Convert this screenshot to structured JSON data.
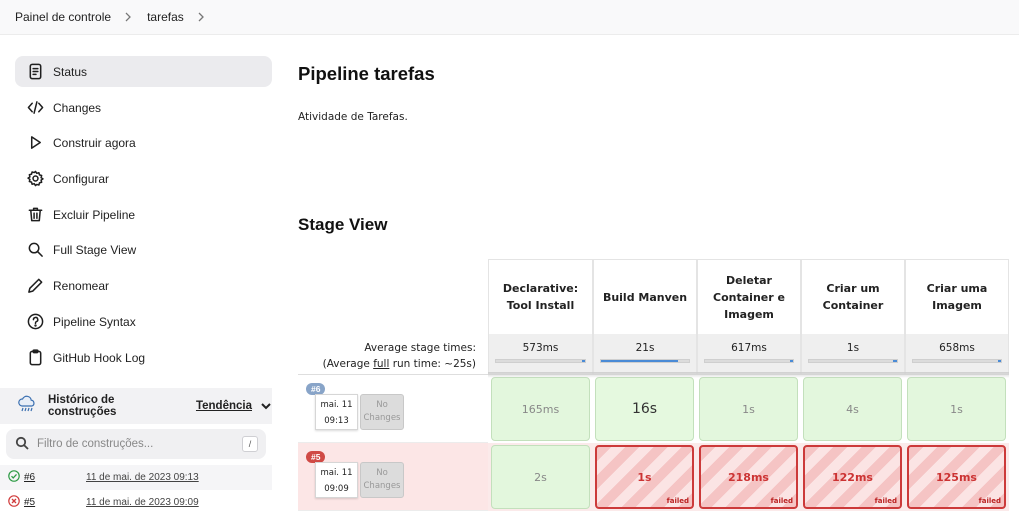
{
  "breadcrumb": [
    "Painel de controle",
    "tarefas"
  ],
  "sidebar": {
    "items": [
      {
        "label": "Status",
        "icon": "document-icon",
        "active": true
      },
      {
        "label": "Changes",
        "icon": "code-icon"
      },
      {
        "label": "Construir agora",
        "icon": "play-icon"
      },
      {
        "label": "Configurar",
        "icon": "gear-icon"
      },
      {
        "label": "Excluir Pipeline",
        "icon": "trash-icon"
      },
      {
        "label": "Full Stage View",
        "icon": "search-icon"
      },
      {
        "label": "Renomear",
        "icon": "pencil-icon"
      },
      {
        "label": "Pipeline Syntax",
        "icon": "help-icon"
      },
      {
        "label": "GitHub Hook Log",
        "icon": "clipboard-icon"
      }
    ]
  },
  "history": {
    "title": "Histórico de construções",
    "trend_label": "Tendência",
    "filter_placeholder": "Filtro de construções...",
    "filter_shortcut": "/",
    "builds": [
      {
        "number": "#6",
        "date": "11 de mai. de 2023 09:13",
        "status": "success"
      },
      {
        "number": "#5",
        "date": "11 de mai. de 2023 09:09",
        "status": "failed"
      }
    ]
  },
  "main": {
    "title": "Pipeline tarefas",
    "description": "Atividade de Tarefas.",
    "stage_view_title": "Stage View"
  },
  "stage_view": {
    "avg_label": "Average stage times:",
    "avg_run_prefix": "(Average ",
    "avg_run_link": "full",
    "avg_run_suffix": " run time: ~25s)",
    "stages": [
      {
        "name": "Declarative: Tool Install",
        "avg": "573ms",
        "avg_fraction": 0.03
      },
      {
        "name": "Build Manven",
        "avg": "21s",
        "avg_fraction": 0.87
      },
      {
        "name": "Deletar Container e Imagem",
        "avg": "617ms",
        "avg_fraction": 0.03
      },
      {
        "name": "Criar um Container",
        "avg": "1s",
        "avg_fraction": 0.05
      },
      {
        "name": "Criar uma Imagem",
        "avg": "658ms",
        "avg_fraction": 0.03
      }
    ],
    "no_changes_label": "No Changes",
    "failed_label": "failed",
    "runs": [
      {
        "badge": "#6",
        "date": "mai. 11",
        "time": "09:13",
        "status": "success",
        "cells": [
          {
            "value": "165ms",
            "status": "success"
          },
          {
            "value": "16s",
            "status": "success"
          },
          {
            "value": "1s",
            "status": "success"
          },
          {
            "value": "4s",
            "status": "success"
          },
          {
            "value": "1s",
            "status": "success"
          }
        ]
      },
      {
        "badge": "#5",
        "date": "mai. 11",
        "time": "09:09",
        "status": "failed",
        "cells": [
          {
            "value": "2s",
            "status": "success"
          },
          {
            "value": "1s",
            "status": "failed"
          },
          {
            "value": "218ms",
            "status": "failed"
          },
          {
            "value": "122ms",
            "status": "failed"
          },
          {
            "value": "125ms",
            "status": "failed"
          }
        ]
      }
    ]
  },
  "colors": {
    "success_cell": "#e3f7dd",
    "failed_border": "#cc3a3a",
    "bar_fill": "#4a8bd6"
  }
}
